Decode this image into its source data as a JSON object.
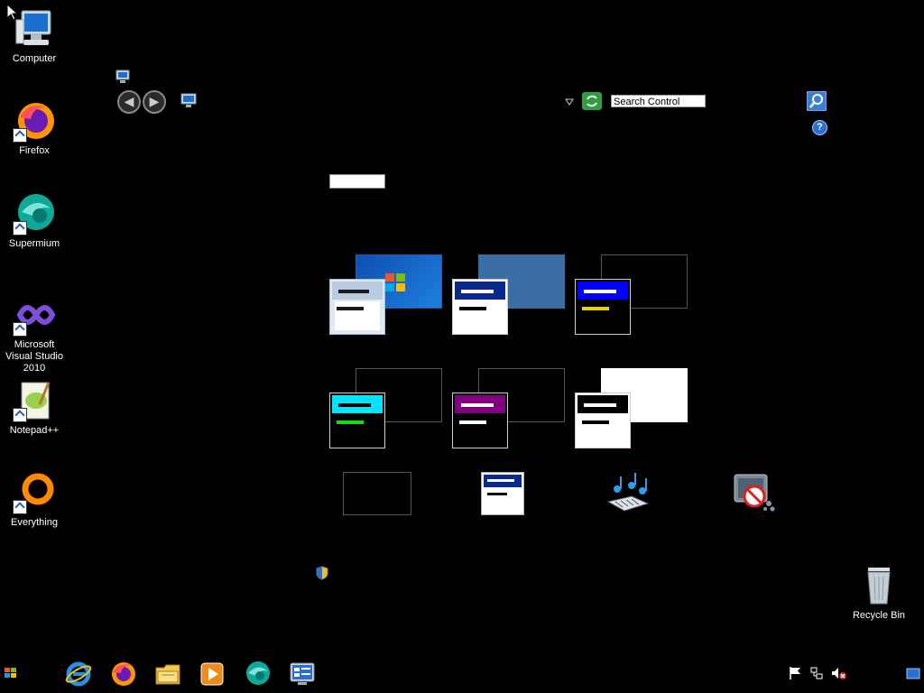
{
  "desktop": {
    "icons": [
      {
        "label": "Computer",
        "icon": "computer-icon"
      },
      {
        "label": "Firefox",
        "icon": "firefox-icon"
      },
      {
        "label": "Supermium",
        "icon": "supermium-icon"
      },
      {
        "label": "Microsoft Visual Studio 2010",
        "icon": "visual-studio-icon"
      },
      {
        "label": "Notepad++",
        "icon": "notepad-plus-plus-icon"
      },
      {
        "label": "Everything",
        "icon": "everything-icon"
      }
    ],
    "recycle_bin": {
      "label": "Recycle Bin",
      "icon": "recycle-bin-icon"
    }
  },
  "control_panel": {
    "search_placeholder": "Search Control Panel",
    "help_glyph": "?",
    "back_glyph": "◀",
    "forward_glyph": "▶"
  },
  "themes": [
    {
      "name": "windows-7",
      "accent": "#1e5fa8",
      "text_color": "#1a1a1a"
    },
    {
      "name": "blue",
      "accent": "#000090",
      "text_color": "#000000"
    },
    {
      "name": "high-contrast-1",
      "accent": "#0000ff",
      "text_color": "#e8d400"
    },
    {
      "name": "cyan",
      "accent": "#00e5ff",
      "text_color": "#10e010"
    },
    {
      "name": "purple",
      "accent": "#800080",
      "text_color": "#ffffff"
    },
    {
      "name": "high-contrast-white",
      "accent": "#000000",
      "text_color": "#000000"
    }
  ],
  "taskbar": {
    "pinned": [
      "internet-explorer-icon",
      "firefox-icon",
      "file-explorer-icon",
      "media-player-icon",
      "supermium-icon",
      "control-panel-icon"
    ],
    "tray": [
      "action-center-flag-icon",
      "network-icon",
      "volume-muted-icon",
      "show-desktop-icon"
    ]
  }
}
